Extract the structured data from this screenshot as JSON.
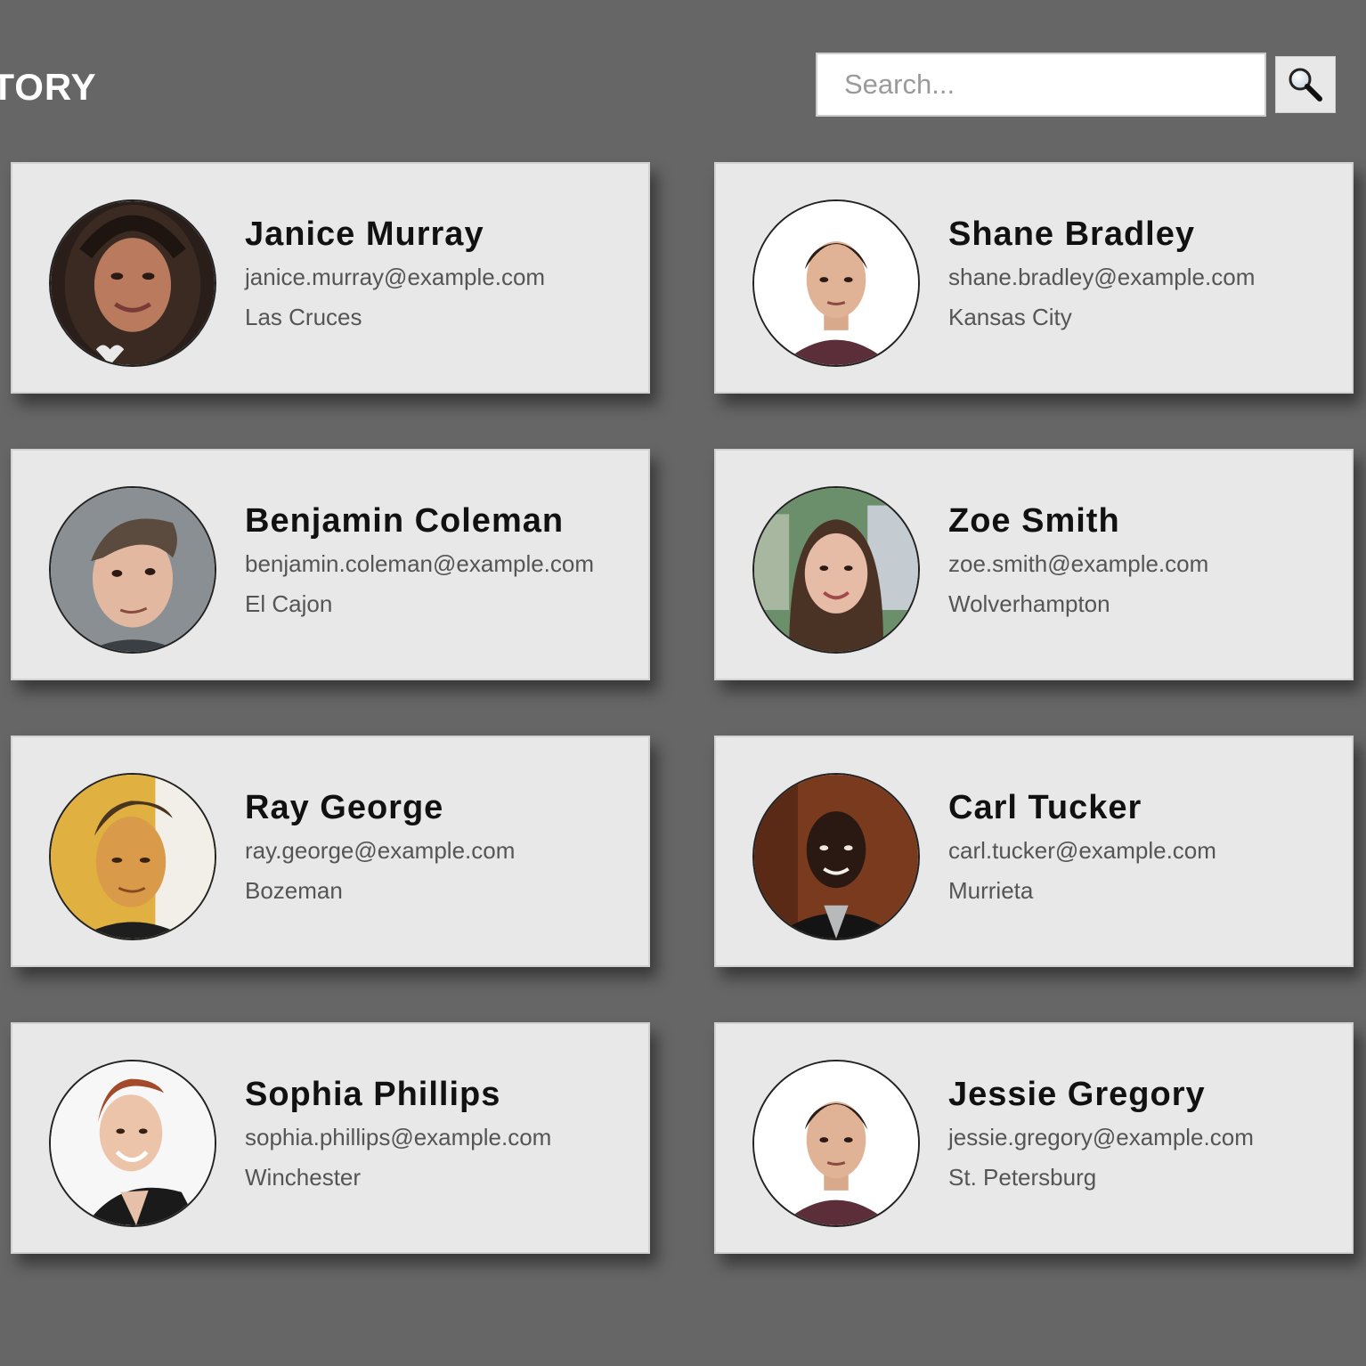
{
  "header": {
    "title": "ECTORY",
    "search_placeholder": "Search..."
  },
  "icons": {
    "search_button": "magnifier-icon"
  },
  "users": [
    {
      "name": "Janice Murray",
      "email": "janice.murray@example.com",
      "city": "Las Cruces"
    },
    {
      "name": "Shane Bradley",
      "email": "shane.bradley@example.com",
      "city": "Kansas City"
    },
    {
      "name": "Benjamin Coleman",
      "email": "benjamin.coleman@example.com",
      "city": "El Cajon"
    },
    {
      "name": "Zoe Smith",
      "email": "zoe.smith@example.com",
      "city": "Wolverhampton"
    },
    {
      "name": "Ray George",
      "email": "ray.george@example.com",
      "city": "Bozeman"
    },
    {
      "name": "Carl Tucker",
      "email": "carl.tucker@example.com",
      "city": "Murrieta"
    },
    {
      "name": "Sophia Phillips",
      "email": "sophia.phillips@example.com",
      "city": "Winchester"
    },
    {
      "name": "Jessie Gregory",
      "email": "jessie.gregory@example.com",
      "city": "St. Petersburg"
    }
  ],
  "colors": {
    "background": "#666666",
    "card": "#e8e8e8",
    "name_text": "#111111",
    "detail_text": "#555555"
  }
}
